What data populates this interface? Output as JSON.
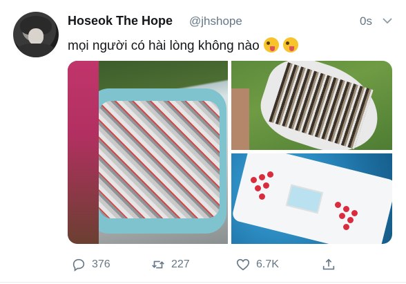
{
  "tweet": {
    "display_name": "Hoseok The Hope",
    "handle": "@jhshope",
    "time": "0s",
    "text": "mọi người có hài lòng không nào",
    "emojis": [
      "zany-face-icon",
      "zany-face-icon"
    ]
  },
  "media": [
    {
      "description": "inflatable-pool-of-cans"
    },
    {
      "description": "canoe-filled-with-bottles"
    },
    {
      "description": "beer-pong-pool-float"
    }
  ],
  "actions": {
    "reply_count": "376",
    "retweet_count": "227",
    "like_count": "6.7K"
  },
  "colors": {
    "text": "#14171a",
    "secondary": "#657786",
    "divider": "#e6ecf0"
  }
}
